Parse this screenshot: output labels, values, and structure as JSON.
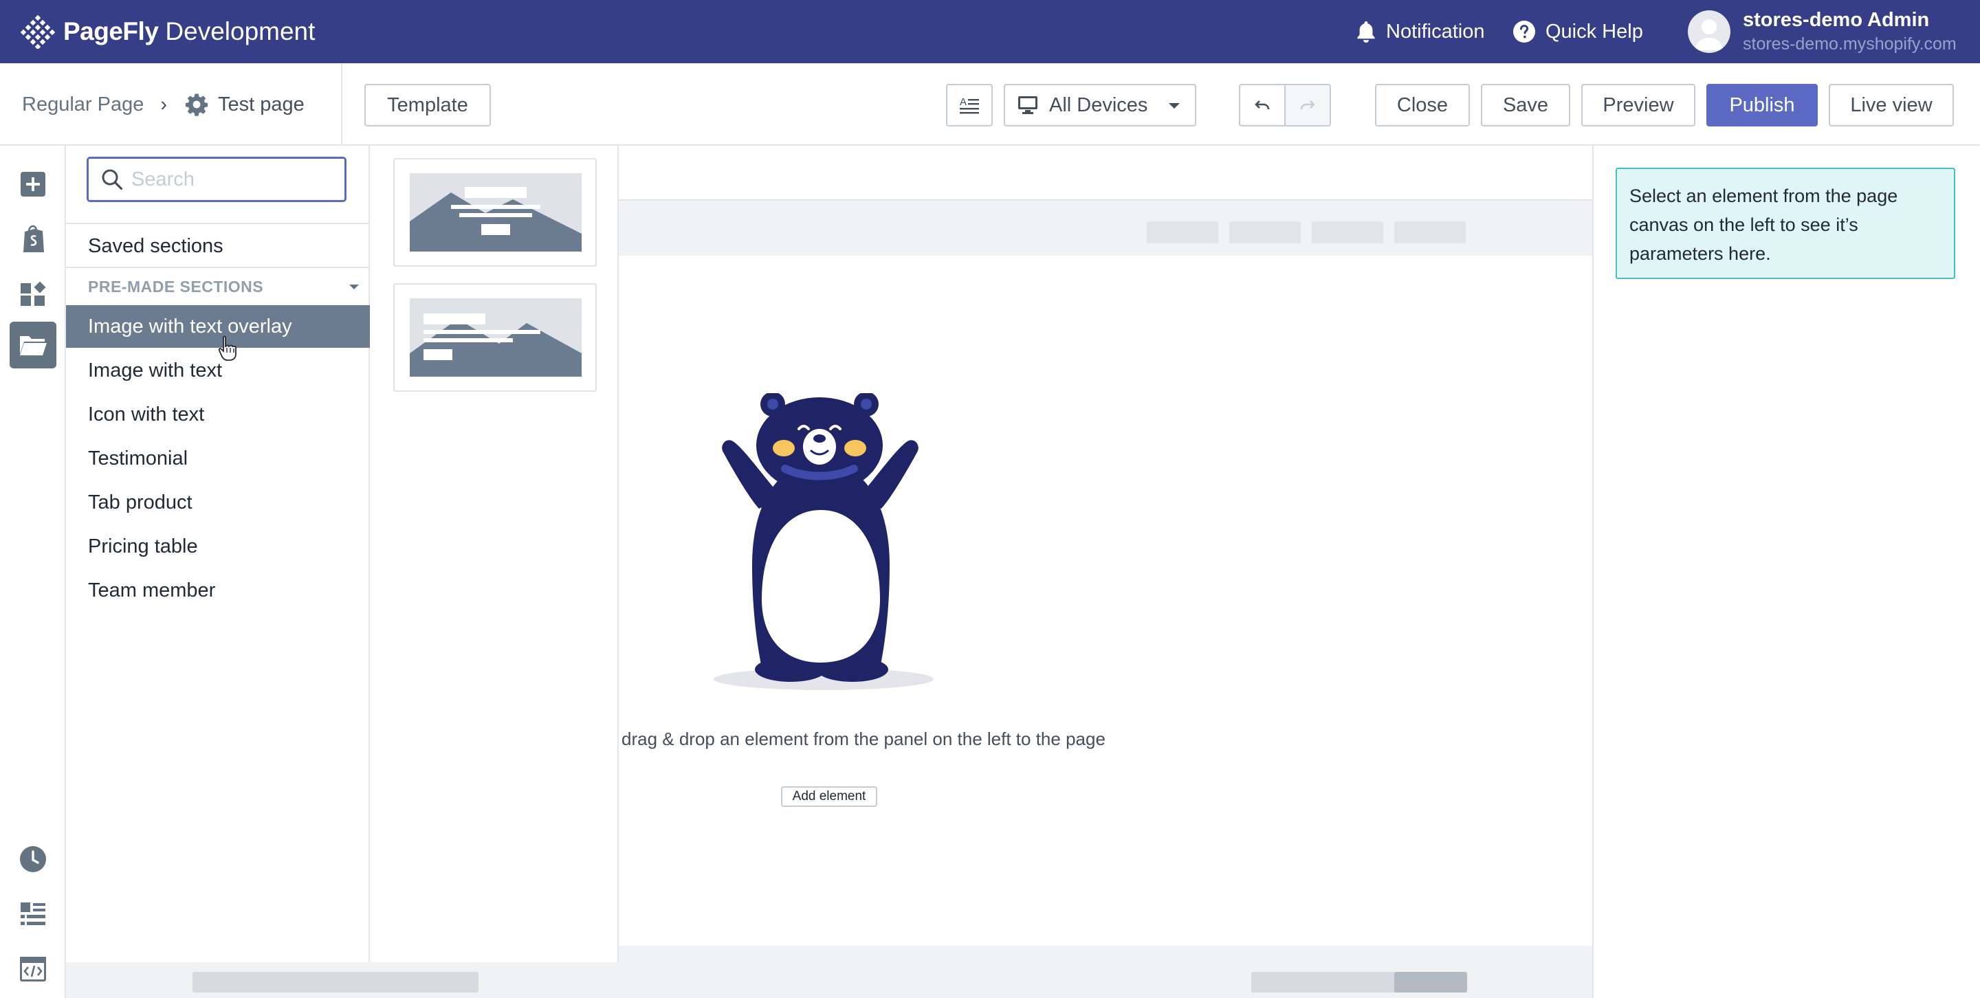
{
  "brand": {
    "name": "PageFly",
    "env": "Development"
  },
  "topbar": {
    "notification_label": "Notification",
    "quick_help_label": "Quick Help",
    "user_name": "stores-demo Admin",
    "user_store": "stores-demo.myshopify.com"
  },
  "breadcrumb": {
    "parent": "Regular Page",
    "separator": "›",
    "page": "Test page"
  },
  "toolbar": {
    "template_label": "Template",
    "devices_label": "All Devices",
    "close_label": "Close",
    "save_label": "Save",
    "preview_label": "Preview",
    "publish_label": "Publish",
    "live_view_label": "Live view"
  },
  "sections_panel": {
    "search_placeholder": "Search",
    "saved_label": "Saved sections",
    "premade_header": "PRE-MADE SECTIONS",
    "items": [
      {
        "label": "Image with text overlay"
      },
      {
        "label": "Image with text"
      },
      {
        "label": "Icon with text"
      },
      {
        "label": "Testimonial"
      },
      {
        "label": "Tab product"
      },
      {
        "label": "Pricing table"
      },
      {
        "label": "Team member"
      }
    ],
    "selected_item": "Image with text overlay"
  },
  "canvas": {
    "drag_text": "drag & drop an element from the panel on the left to the page",
    "add_element_label": "Add element"
  },
  "settings": {
    "info_text": "Select an element from the page canvas on the left to see it’s parameters here."
  },
  "icons": {
    "rail": [
      "plus-icon",
      "shopify-bag-icon",
      "widgets-icon",
      "folder-icon",
      "history-icon",
      "list-icon",
      "code-icon"
    ]
  },
  "colors": {
    "topbar": "#353e87",
    "primary": "#5c6ac4",
    "selected_item": "#6b7b90",
    "info_border": "#47c1bf",
    "info_bg": "#e0f5f5",
    "bear_body": "#1f2466"
  }
}
